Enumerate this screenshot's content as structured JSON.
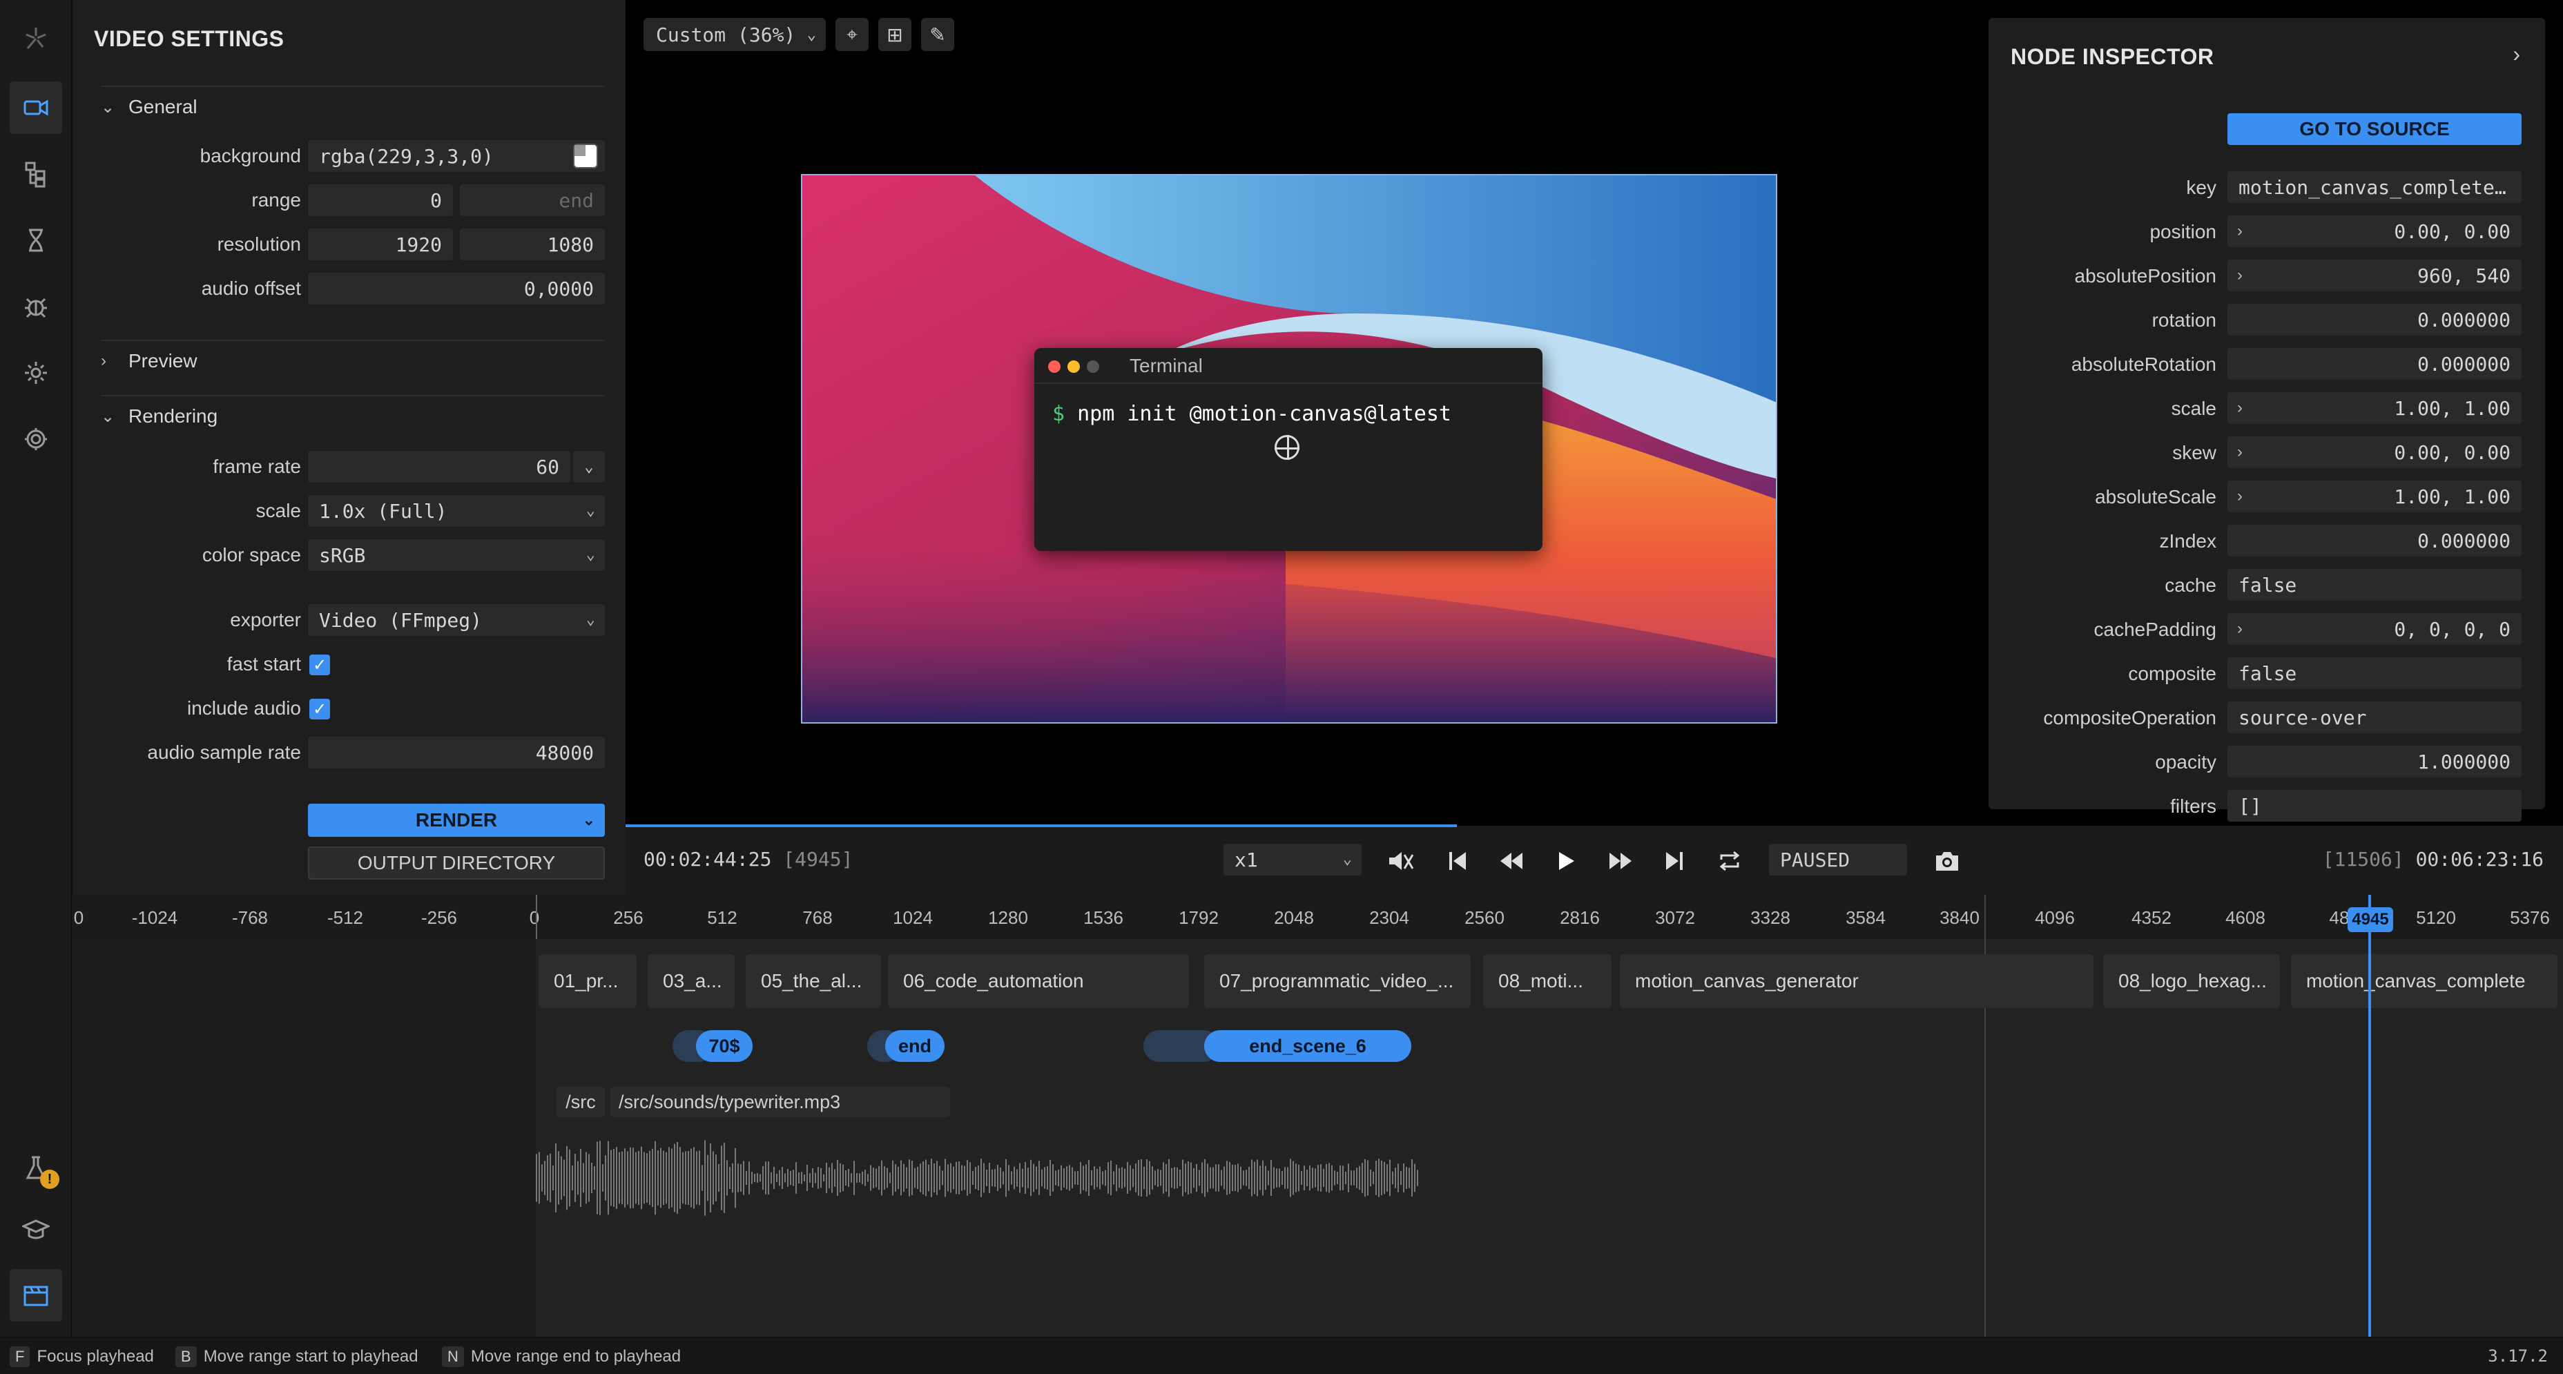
{
  "iconbar": {
    "items": [
      "logo-icon",
      "video-settings-icon",
      "scene-graph-icon",
      "timing-icon",
      "debug-icon",
      "settings-icon",
      "app-settings-icon"
    ],
    "bottom": [
      "experiments-icon",
      "learn-icon",
      "timeline-icon"
    ],
    "badge": "!"
  },
  "settings": {
    "title": "VIDEO SETTINGS",
    "general": {
      "label": "General",
      "background_label": "background",
      "background_value": "rgba(229,3,3,0)",
      "range_label": "range",
      "range_start": "0",
      "range_end_placeholder": "end",
      "resolution_label": "resolution",
      "res_w": "1920",
      "res_h": "1080",
      "audio_offset_label": "audio offset",
      "audio_offset": "0,0000"
    },
    "preview": {
      "label": "Preview"
    },
    "rendering": {
      "label": "Rendering",
      "frame_rate_label": "frame rate",
      "frame_rate": "60",
      "scale_label": "scale",
      "scale": "1.0x (Full)",
      "color_space_label": "color space",
      "color_space": "sRGB",
      "exporter_label": "exporter",
      "exporter": "Video (FFmpeg)",
      "fast_start_label": "fast start",
      "include_audio_label": "include audio",
      "sample_rate_label": "audio sample rate",
      "sample_rate": "48000",
      "render_label": "RENDER",
      "output_label": "OUTPUT DIRECTORY"
    }
  },
  "viewport": {
    "zoom": "Custom (36%)",
    "terminal_title": "Terminal",
    "prompt": "$",
    "command": "npm init @motion-canvas@latest"
  },
  "inspector": {
    "title": "NODE INSPECTOR",
    "go_to_source": "GO TO SOURCE",
    "props": [
      {
        "label": "key",
        "value": "motion_canvas_complete…",
        "align": "l",
        "expand": false
      },
      {
        "label": "position",
        "value": "0.00, 0.00",
        "align": "r",
        "expand": true
      },
      {
        "label": "absolutePosition",
        "value": "960, 540",
        "align": "r",
        "expand": true
      },
      {
        "label": "rotation",
        "value": "0.000000",
        "align": "r",
        "expand": false
      },
      {
        "label": "absoluteRotation",
        "value": "0.000000",
        "align": "r",
        "expand": false
      },
      {
        "label": "scale",
        "value": "1.00, 1.00",
        "align": "r",
        "expand": true
      },
      {
        "label": "skew",
        "value": "0.00, 0.00",
        "align": "r",
        "expand": true
      },
      {
        "label": "absoluteScale",
        "value": "1.00, 1.00",
        "align": "r",
        "expand": true
      },
      {
        "label": "zIndex",
        "value": "0.000000",
        "align": "r",
        "expand": false
      },
      {
        "label": "cache",
        "value": "false",
        "align": "l",
        "expand": false
      },
      {
        "label": "cachePadding",
        "value": "0, 0, 0, 0",
        "align": "r",
        "expand": true
      },
      {
        "label": "composite",
        "value": "false",
        "align": "l",
        "expand": false
      },
      {
        "label": "compositeOperation",
        "value": "source-over",
        "align": "l",
        "expand": false
      },
      {
        "label": "opacity",
        "value": "1.000000",
        "align": "r",
        "expand": false
      },
      {
        "label": "filters",
        "value": "[]",
        "align": "l",
        "expand": false
      }
    ]
  },
  "playback": {
    "time": "00:02:44:25",
    "frame": "[4945]",
    "speed": "x1",
    "status": "PAUSED",
    "end_frame": "[11506]",
    "end_time": "00:06:23:16",
    "progress": 0.43
  },
  "timeline": {
    "ticks": [
      "0",
      "-1024",
      "-768",
      "-512",
      "-256",
      "0",
      "256",
      "512",
      "768",
      "1024",
      "1280",
      "1536",
      "1792",
      "2048",
      "2304",
      "2560",
      "2816",
      "3072",
      "3328",
      "3584",
      "3840",
      "4096",
      "4352",
      "4608",
      "48",
      "5120",
      "5376"
    ],
    "playhead": "4945",
    "clips": [
      "01_pr...",
      "03_a...",
      "05_the_al...",
      "06_code_automation",
      "07_programmatic_video_...",
      "08_moti...",
      "motion_canvas_generator",
      "08_logo_hexag...",
      "motion_canvas_complete"
    ],
    "labels": [
      "70$",
      "end",
      "end_scene_6"
    ],
    "audio_short": "/src",
    "audio_path": "/src/sounds/typewriter.mp3"
  },
  "footer": {
    "k1": "F",
    "t1": "Focus playhead",
    "k2": "B",
    "t2": "Move range start to playhead",
    "k3": "N",
    "t3": "Move range end to playhead",
    "version": "3.17.2"
  },
  "colors": {
    "accent": "#3a8ff0",
    "panel": "#1e1e1e",
    "bg": "#141414"
  }
}
